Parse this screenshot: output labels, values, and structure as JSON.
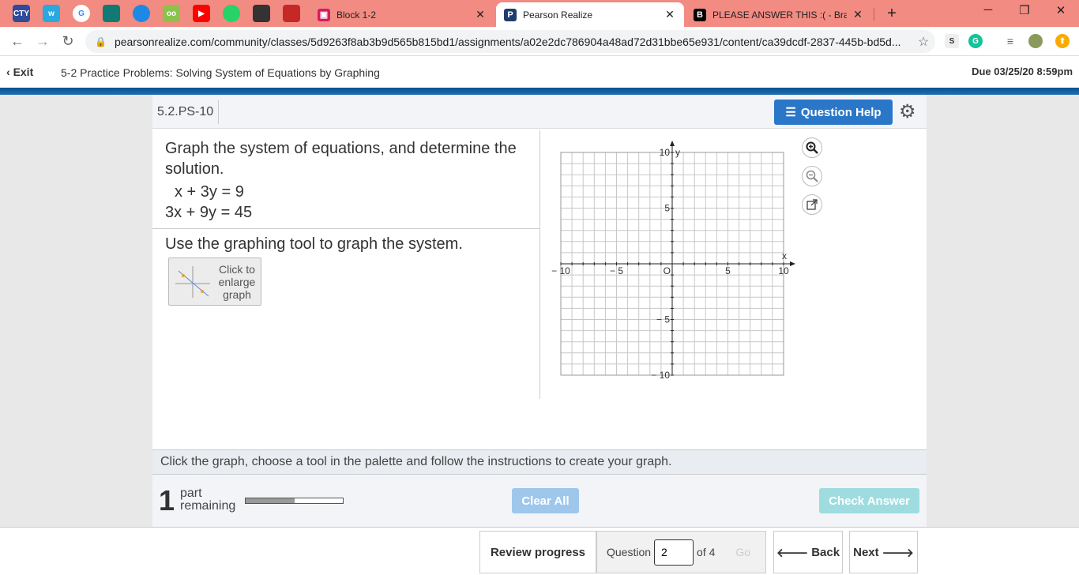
{
  "browser": {
    "tabs": [
      {
        "title": "Block 1-2",
        "close": "✕"
      },
      {
        "title": "Pearson Realize",
        "close": "✕"
      },
      {
        "title": "PLEASE ANSWER THIS :( - Brainly",
        "close": "✕"
      }
    ],
    "pinned": [
      "CTY",
      "w",
      "G",
      "",
      "",
      "oo",
      "▶",
      "",
      "",
      ""
    ],
    "new_tab": "+",
    "url": "pearsonrealize.com/community/classes/5d9263f8ab3b9d565b815bd1/assignments/a02e2dc786904a48ad72d31bbe65e931/content/ca39dcdf-2837-445b-bd5d...",
    "ext_s": "S",
    "ext_g": "G"
  },
  "assignment": {
    "exit_label": "Exit",
    "title": "5-2 Practice Problems: Solving System of Equations by Graphing",
    "due": "Due 03/25/20 8:59pm"
  },
  "question": {
    "id": "5.2.PS-10",
    "help_label": "Question Help",
    "prompt": "Graph the system of equations, and determine the solution.",
    "equations": [
      "x + 3y = 9",
      "3x + 9y = 45"
    ],
    "instruction": "Use the graphing tool to graph the system.",
    "enlarge_label": "Click to enlarge graph",
    "footer_message": "Click the graph, choose a tool in the palette and follow the instructions to create your graph.",
    "parts_remaining": "1",
    "parts_label_1": "part",
    "parts_label_2": "remaining",
    "progress": 0.5,
    "clear_label": "Clear All",
    "check_label": "Check Answer"
  },
  "graph": {
    "x_label": "x",
    "y_label": "y",
    "origin_label": "O",
    "range": [
      -10,
      10
    ],
    "ticks": [
      {
        "v": -10,
        "label": "− 10"
      },
      {
        "v": -5,
        "label": "− 5"
      },
      {
        "v": 5,
        "label": "5"
      },
      {
        "v": 10,
        "label": "10"
      }
    ]
  },
  "nav": {
    "review_label": "Review progress",
    "question_label": "Question",
    "current": "2",
    "of_label": "of 4",
    "go_label": "Go",
    "back_label": "Back",
    "next_label": "Next"
  }
}
